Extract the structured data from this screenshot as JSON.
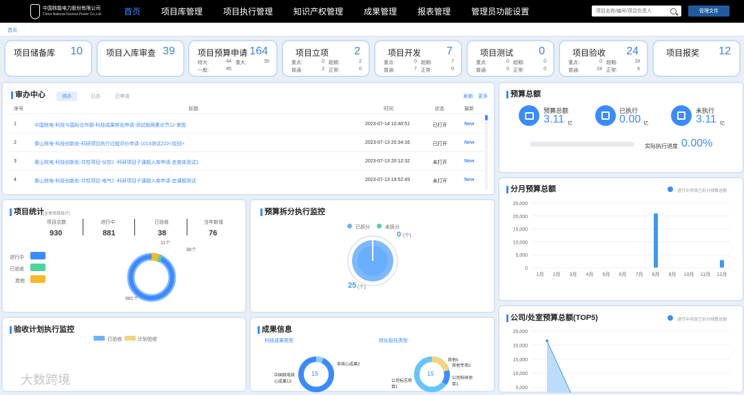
{
  "header": {
    "logo_cn": "中国核能电力股份有限公司",
    "logo_en": "China National Nuclear Power Co.,Ltd.",
    "logo_mark": "中国核电",
    "nav": [
      "首页",
      "项目库管理",
      "项目执行管理",
      "知识产权管理",
      "成果管理",
      "报表管理",
      "管理员功能设置"
    ],
    "search_placeholder": "项目名称/编号/项目负责人",
    "manage_files": "管理文件"
  },
  "breadcrumb": "首页",
  "stats": [
    {
      "name": "项目储备库",
      "value": "10",
      "subs": []
    },
    {
      "name": "项目入库审查",
      "value": "39",
      "subs": []
    },
    {
      "name": "项目预算申请",
      "value": "164",
      "subs": [
        [
          "特大:",
          "44"
        ],
        [
          "重大:",
          "35"
        ],
        [
          "一般:",
          "85"
        ]
      ]
    },
    {
      "name": "项目立项",
      "value": "2",
      "subs": [
        [
          "重点:",
          "0"
        ],
        [
          "超期:",
          "2"
        ],
        [
          "普通:",
          "2"
        ],
        [
          "正常:",
          "0"
        ]
      ]
    },
    {
      "name": "项目开发",
      "value": "7",
      "subs": [
        [
          "重点:",
          "0"
        ],
        [
          "超期:",
          "7"
        ],
        [
          "普通:",
          "7"
        ],
        [
          "正常:",
          "0"
        ]
      ]
    },
    {
      "name": "项目测试",
      "value": "0",
      "subs": [
        [
          "重点:",
          "0"
        ],
        [
          "超期:",
          "0"
        ],
        [
          "普通:",
          "0"
        ],
        [
          "正常:",
          "0"
        ]
      ]
    },
    {
      "name": "项目验收",
      "value": "24",
      "subs": [
        [
          "重点:",
          "0"
        ],
        [
          "超期:",
          "18"
        ],
        [
          "普通:",
          "24"
        ],
        [
          "正常:",
          "6"
        ]
      ]
    },
    {
      "name": "项目报奖",
      "value": "12",
      "subs": []
    }
  ],
  "todo": {
    "title": "审办中心",
    "tabs": [
      "待办",
      "已办",
      "已申请"
    ],
    "refresh": "刷新",
    "more": "更多",
    "columns": [
      "序号",
      "标题",
      "时间",
      "状态",
      "最新"
    ],
    "rows": [
      {
        "no": "1",
        "title": "中国核电-科技与国际合作部-科技成果转化申请-测试假两重论节12-审批",
        "time": "2023-07-14 10:40:51",
        "status": "已打开",
        "badge": "New"
      },
      {
        "no": "2",
        "title": "秦山核电-科技创新处-科研项目执行过程评价申请-1014测试222<驳回>",
        "time": "2023-07-13 20:34:16",
        "status": "已打开",
        "badge": "New"
      },
      {
        "no": "3",
        "title": "秦山核电-科技创新处-共性项目-仪控1 -科研项目子课题入库申请-走查体测试1",
        "time": "2023-07-13 20:12:32",
        "status": "未打开",
        "badge": "New"
      },
      {
        "no": "4",
        "title": "秦山核电-科技创新处-共性项目-电气1 -科研项目子课题入库申请-走课题测试",
        "time": "2023-07-13 19:52:49",
        "status": "未打开",
        "badge": "New"
      }
    ]
  },
  "budget_total": {
    "title": "预算总额",
    "items": [
      {
        "label": "预算总额",
        "value": "3.11",
        "unit": "亿"
      },
      {
        "label": "已执行",
        "value": "0.00",
        "unit": "亿"
      },
      {
        "label": "未执行",
        "value": "3.11",
        "unit": "亿"
      }
    ],
    "progress_label": "实际执行进度",
    "progress_value": "0.00%",
    "progress_fraction": 0
  },
  "monthly": {
    "title": "分月预算总额",
    "legend": "进行中项目已拆分预算总额"
  },
  "project_stats": {
    "title": "项目统计",
    "subtitle": "(全体项目统计)",
    "cols": [
      {
        "label": "项目总数",
        "value": "930"
      },
      {
        "label": "进行中",
        "value": "881"
      },
      {
        "label": "已验收",
        "value": "38"
      },
      {
        "label": "当年新增",
        "value": "76"
      }
    ],
    "legend": [
      "进行中",
      "已验收",
      "其他"
    ],
    "labels": {
      "a": "11个",
      "b": "38个",
      "c": "881个"
    }
  },
  "split_monitor": {
    "title": "预算拆分执行监控",
    "legend": [
      "已拆分",
      "未拆分"
    ],
    "value_top": "0",
    "value_top_unit": "(个)",
    "value_bottom": "25",
    "value_bottom_unit": "(个)"
  },
  "company_top5": {
    "title": "公司/处室预算总额(TOP5)",
    "legend": "进行中项目已拆分预算总额"
  },
  "acceptance": {
    "title": "验收计划执行监控",
    "legend": [
      "已验收",
      "计划验收"
    ]
  },
  "results": {
    "title": "成果信息",
    "tab1": "科技成果类型",
    "tab2": "转化取托类型",
    "center1": "15",
    "center2": "15",
    "l1a": "中国核电核心成果13",
    "l1b": "非核心成果2",
    "l2a": "公司标志项目1",
    "l2b": "其他0",
    "l2c": "其他专项2",
    "l2d": "公司科研项目1"
  },
  "watermark": "大数跨境",
  "chart_data": [
    {
      "type": "bar",
      "title": "分月预算总额",
      "categories": [
        "1月",
        "2月",
        "3月",
        "4月",
        "5月",
        "6月",
        "7月",
        "8月",
        "9月",
        "10月",
        "11月",
        "12月"
      ],
      "series": [
        {
          "name": "进行中项目已拆分预算总额",
          "values": [
            0,
            0,
            0,
            0,
            0,
            0,
            0,
            21000,
            0,
            0,
            0,
            3000
          ]
        }
      ],
      "ylim": [
        0,
        25000
      ],
      "yticks": [
        "0",
        "5,000",
        "10,000",
        "15,000",
        "20,000",
        "25,000"
      ],
      "color": "#3b9af2"
    },
    {
      "type": "area",
      "title": "公司/处室预算总额(TOP5)",
      "series": [
        {
          "name": "进行中项目已拆分预算总额",
          "values": [
            21500,
            0
          ]
        }
      ],
      "ylim": [
        0,
        25000
      ],
      "yticks": [
        "5,000",
        "10,000",
        "15,000",
        "20,000",
        "25,000"
      ],
      "color": "#3b9af2"
    }
  ]
}
